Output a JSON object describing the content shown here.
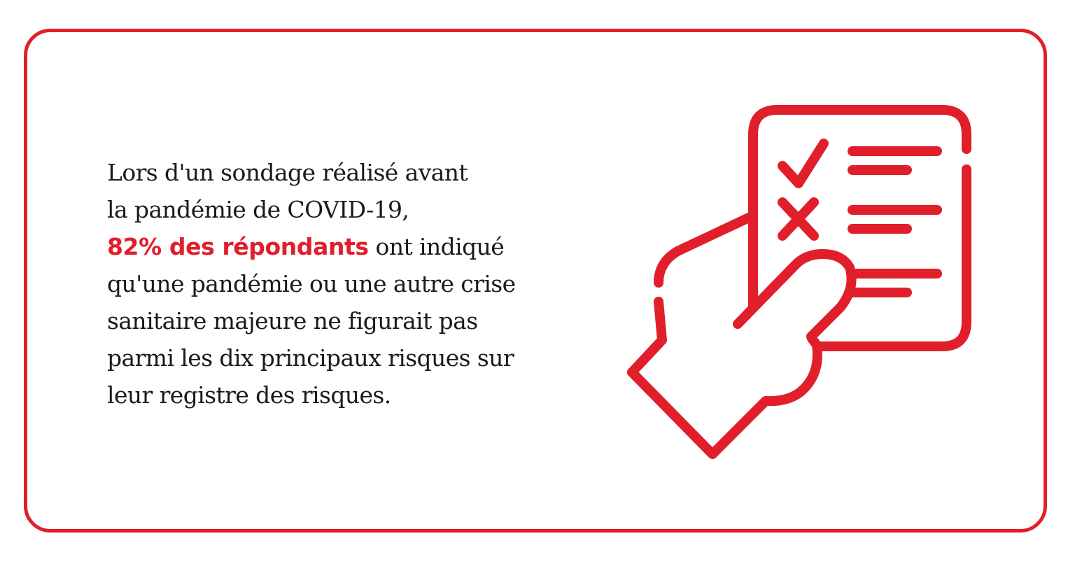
{
  "statement": {
    "line1": "Lors d'un sondage réalisé avant",
    "line2": "la pandémie de COVID-19,",
    "highlight": "82% des répondants",
    "line3_rest": " ont indiqué",
    "line4": "qu'une pandémie ou une autre crise",
    "line5": "sanitaire majeure ne figurait pas",
    "line6": "parmi les dix principaux risques sur",
    "line7": "leur registre des risques."
  },
  "illustration": {
    "icon": "hand-holding-checklist-icon",
    "color": "#e01f2b"
  },
  "colors": {
    "accent": "#e01f2b",
    "text": "#1a1a1a",
    "background": "#ffffff"
  }
}
